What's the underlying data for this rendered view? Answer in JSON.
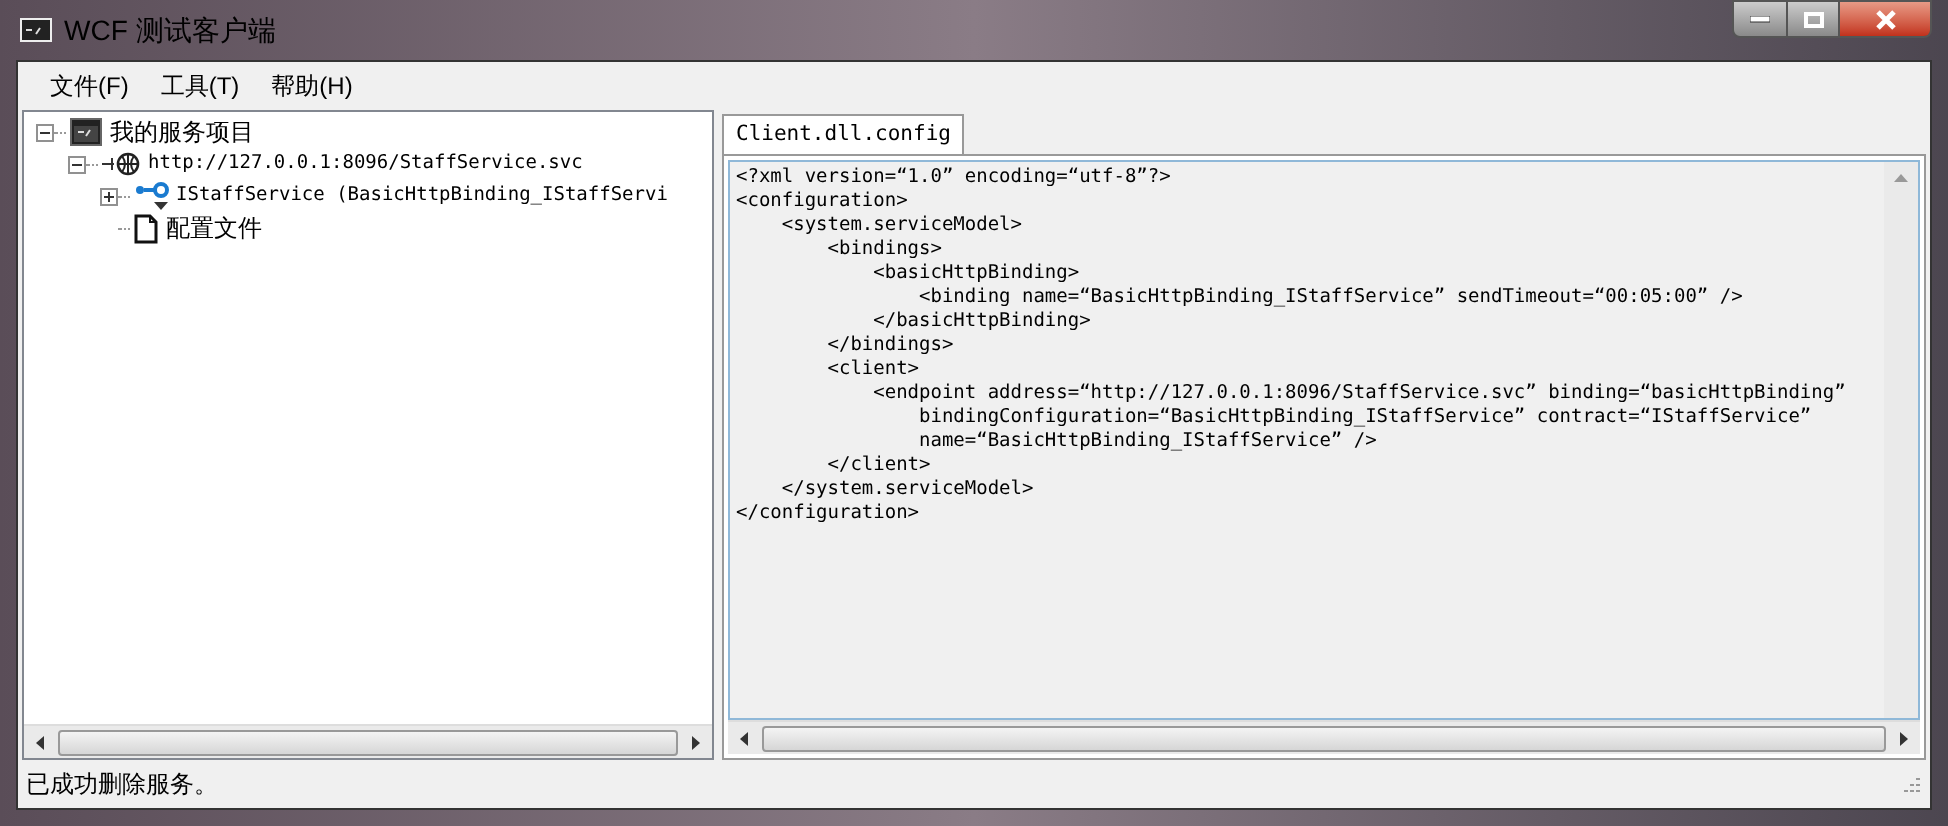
{
  "window": {
    "title": "WCF 测试客户端"
  },
  "menu": [
    "文件(F)",
    "工具(T)",
    "帮助(H)"
  ],
  "tree": [
    {
      "label": "我的服务项目",
      "kind": "project",
      "expanded": true,
      "children": [
        {
          "label": "http://127.0.0.1:8096/StaffService.svc",
          "kind": "service",
          "expanded": true,
          "children": [
            {
              "label": "IStaffService (BasicHttpBinding_IStaffServi",
              "kind": "contract",
              "expanded": false
            },
            {
              "label": "配置文件",
              "kind": "file"
            }
          ]
        }
      ]
    }
  ],
  "tabs": [
    {
      "label": "Client.dll.config",
      "selected": true
    }
  ],
  "editor": {
    "lines": [
      "<?xml version=“1.0” encoding=“utf-8”?>",
      "<configuration>",
      "    <system.serviceModel>",
      "        <bindings>",
      "            <basicHttpBinding>",
      "                <binding name=“BasicHttpBinding_IStaffService” sendTimeout=“00:05:00” />",
      "            </basicHttpBinding>",
      "        </bindings>",
      "        <client>",
      "            <endpoint address=“http://127.0.0.1:8096/StaffService.svc” binding=“basicHttpBinding”",
      "                bindingConfiguration=“BasicHttpBinding_IStaffService” contract=“IStaffService”",
      "                name=“BasicHttpBinding_IStaffService” />",
      "        </client>",
      "    </system.serviceModel>",
      "</configuration>"
    ]
  },
  "status_bar": "已成功删除服务。"
}
